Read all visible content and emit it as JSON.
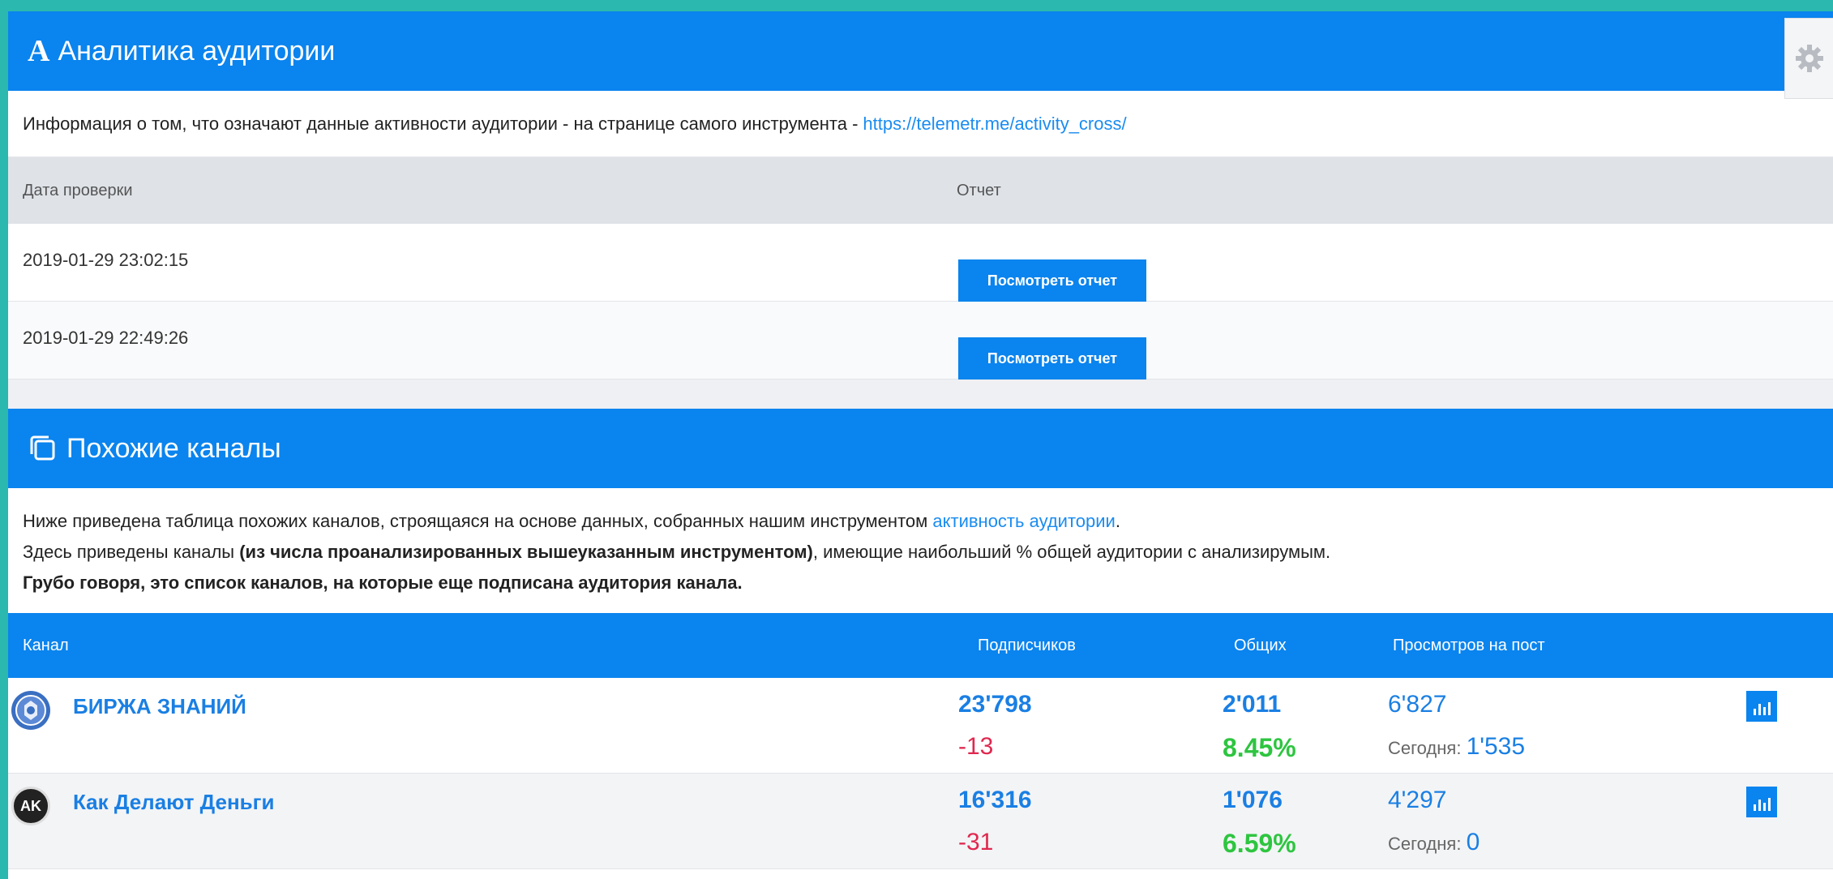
{
  "audience": {
    "icon": "A",
    "title": "Аналитика аудитории",
    "info_text": "Информация о том, что означают данные активности аудитории - на странице самого инструмента -",
    "info_link": "https://telemetr.me/activity_cross/",
    "columns": {
      "date": "Дата проверки",
      "report": "Отчет"
    },
    "rows": [
      {
        "date": "2019-01-29 23:02:15",
        "button": "Посмотреть отчет"
      },
      {
        "date": "2019-01-29 22:49:26",
        "button": "Посмотреть отчет"
      }
    ]
  },
  "similar": {
    "title": "Похожие каналы",
    "desc1_pre": "Ниже приведена таблица похожих каналов, строящаяся на основе данных, собранных нашим инструментом",
    "desc1_link": "активность аудитории",
    "desc1_post": ".",
    "desc2_pre": "Здесь приведены каналы",
    "desc2_bold": "(из числа проанализированных вышеуказанным инструментом)",
    "desc2_post": ", имеющие наибольший % общей аудитории с анализирумым.",
    "desc3": "Грубо говоря, это список каналов, на которые еще подписана аудитория канала.",
    "columns": {
      "channel": "Канал",
      "subscribers": "Подписчиков",
      "common": "Общих",
      "views": "Просмотров на пост"
    },
    "channels": [
      {
        "avatar": "",
        "avatar_color": "#3a6fc2",
        "name": "БИРЖА ЗНАНИЙ",
        "subscribers": "23'798",
        "delta": "-13",
        "common": "2'011",
        "common_pct": "8.45%",
        "views": "6'827",
        "today_label": "Сегодня:",
        "today_value": "1'535"
      },
      {
        "avatar": "AK",
        "avatar_color": "#222222",
        "name": "Как Делают Деньги",
        "subscribers": "16'316",
        "delta": "-31",
        "common": "1'076",
        "common_pct": "6.59%",
        "views": "4'297",
        "today_label": "Сегодня:",
        "today_value": "0"
      }
    ]
  }
}
